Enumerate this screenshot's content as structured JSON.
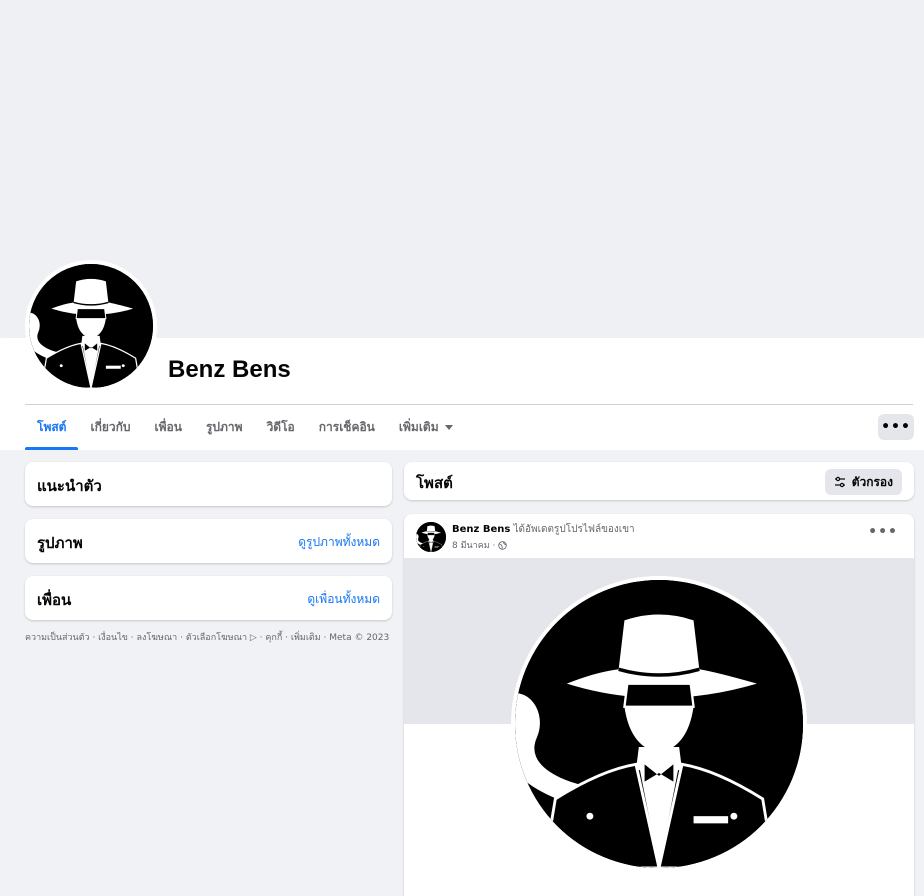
{
  "profile": {
    "name": "Benz Bens"
  },
  "tabs": [
    {
      "label": "โพสต์",
      "active": true
    },
    {
      "label": "เกี่ยวกับ"
    },
    {
      "label": "เพื่อน"
    },
    {
      "label": "รูปภาพ"
    },
    {
      "label": "วิดีโอ"
    },
    {
      "label": "การเช็คอิน"
    },
    {
      "label": "เพิ่มเติม"
    }
  ],
  "more_button": "•••",
  "sidebar": {
    "intro_title": "แนะนำตัว",
    "photos_title": "รูปภาพ",
    "photos_link": "ดูรูปภาพทั้งหมด",
    "friends_title": "เพื่อน",
    "friends_link": "ดูเพื่อนทั้งหมด",
    "footer": "ความเป็นส่วนตัว · เงื่อนไข · ลงโฆษณา · ตัวเลือกโฆษณา ▷ · คุกกี้ · เพิ่มเติม · Meta © 2023"
  },
  "posts_header": {
    "title": "โพสต์",
    "filter_label": "ตัวกรอง"
  },
  "post": {
    "author": "Benz Bens",
    "action": "ได้อัพเดตรูปโปรไฟล์ของเขา",
    "date": "8 มีนาคม ·",
    "more": "•••"
  },
  "colors": {
    "accent": "#1877f2",
    "background": "#f0f2f5",
    "secondary_text": "#65676b"
  }
}
